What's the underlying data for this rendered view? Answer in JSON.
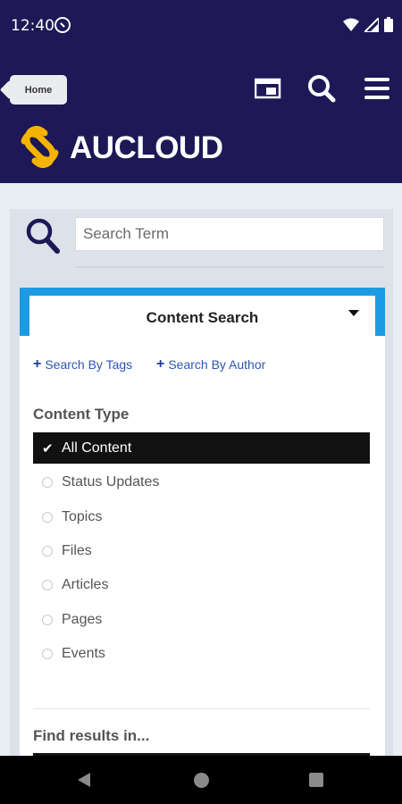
{
  "status": {
    "time": "12:40"
  },
  "header": {
    "home_label": "Home",
    "brand": "AUCLOUD",
    "colors": {
      "bar": "#1e1856",
      "accent": "#f5b400",
      "tab": "#1d9be2"
    }
  },
  "search": {
    "placeholder": "Search Term",
    "value": ""
  },
  "content_search": {
    "tab_title": "Content Search",
    "link_tags": "Search By Tags",
    "link_author": "Search By Author",
    "content_type_title": "Content Type",
    "options": [
      {
        "label": "All Content",
        "selected": true
      },
      {
        "label": "Status Updates",
        "selected": false
      },
      {
        "label": "Topics",
        "selected": false
      },
      {
        "label": "Files",
        "selected": false
      },
      {
        "label": "Articles",
        "selected": false
      },
      {
        "label": "Pages",
        "selected": false
      },
      {
        "label": "Events",
        "selected": false
      }
    ],
    "find_results_title": "Find results in..."
  },
  "icons": [
    "app-notification-icon",
    "wifi-icon",
    "signal-icon",
    "battery-icon",
    "window-icon",
    "search-icon",
    "menu-icon",
    "check-icon",
    "back-nav-icon",
    "home-nav-icon",
    "recents-nav-icon"
  ]
}
